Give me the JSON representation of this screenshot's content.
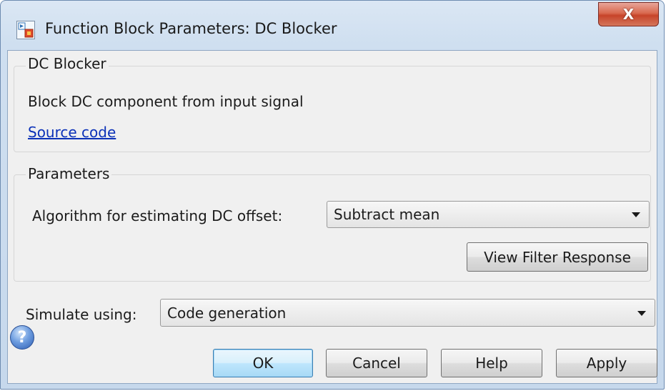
{
  "window": {
    "title": "Function Block Parameters: DC Blocker",
    "close_label": "X"
  },
  "description_group": {
    "label": "DC Blocker",
    "description": "Block DC component from input signal",
    "source_link": "Source code"
  },
  "parameters_group": {
    "label": "Parameters",
    "algorithm_label": "Algorithm for estimating DC offset:",
    "algorithm_value": "Subtract mean",
    "view_filter_button": "View Filter Response"
  },
  "simulate": {
    "label": "Simulate using:",
    "value": "Code generation"
  },
  "footer": {
    "help_icon": "question-mark",
    "ok": "OK",
    "cancel": "Cancel",
    "help": "Help",
    "apply": "Apply"
  },
  "colors": {
    "link": "#0b31b8",
    "close_button": "#c7442a",
    "default_button_border": "#3c7fb1"
  }
}
